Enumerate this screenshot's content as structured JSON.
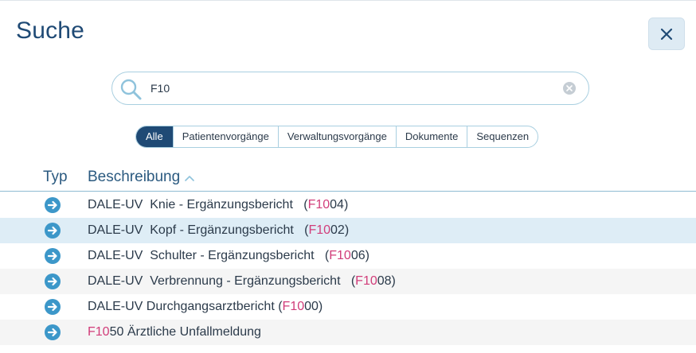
{
  "header": {
    "title": "Suche"
  },
  "search": {
    "value": "F10",
    "placeholder": ""
  },
  "tabs": [
    {
      "label": "Alle",
      "active": true
    },
    {
      "label": "Patientenvorgänge",
      "active": false
    },
    {
      "label": "Verwaltungsvorgänge",
      "active": false
    },
    {
      "label": "Dokumente",
      "active": false
    },
    {
      "label": "Sequenzen",
      "active": false
    }
  ],
  "table": {
    "columns": {
      "type": "Typ",
      "description": "Beschreibung"
    },
    "rows": [
      {
        "before": "DALE-UV  Knie - Ergänzungsbericht   (",
        "match": "F10",
        "after": "04)",
        "selected": false
      },
      {
        "before": "DALE-UV  Kopf - Ergänzungsbericht   (",
        "match": "F10",
        "after": "02)",
        "selected": true
      },
      {
        "before": "DALE-UV  Schulter - Ergänzungsbericht   (",
        "match": "F10",
        "after": "06)",
        "selected": false
      },
      {
        "before": "DALE-UV  Verbrennung - Ergänzungsbericht   (",
        "match": "F10",
        "after": "08)",
        "selected": false
      },
      {
        "before": "DALE-UV Durchgangsarztbericht (",
        "match": "F10",
        "after": "00)",
        "selected": false
      },
      {
        "before": "",
        "match": "F10",
        "after": "50 Ärztliche Unfallmeldung",
        "selected": false
      }
    ]
  },
  "icons": {
    "close": "close-icon",
    "search": "search-icon",
    "clear": "clear-icon",
    "sort": "sort-ascending-icon",
    "row": "arrow-right-circle-icon"
  },
  "colors": {
    "accent": "#1f4a75",
    "highlight": "#d13d7a",
    "row_icon": "#3c97c9",
    "selected_row": "#deedf6"
  }
}
